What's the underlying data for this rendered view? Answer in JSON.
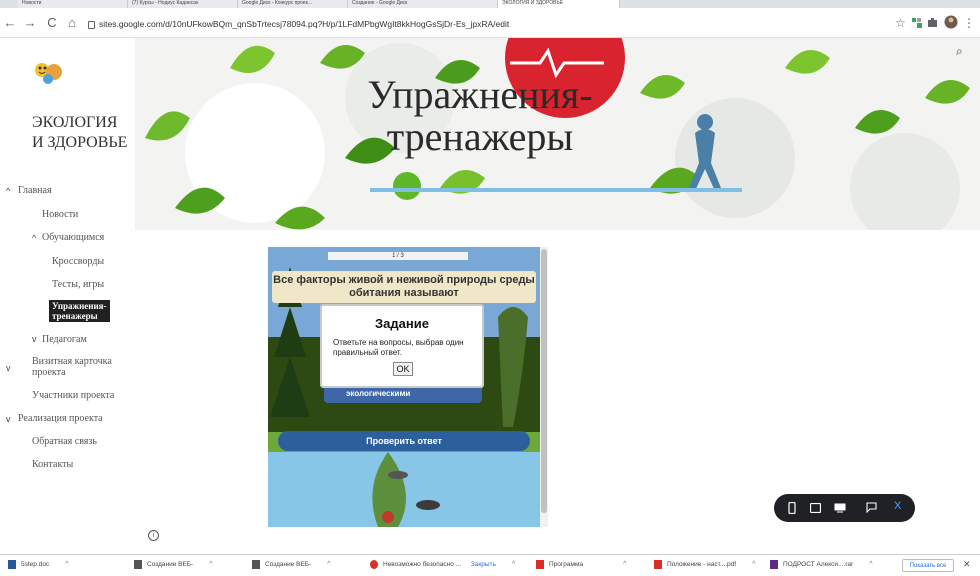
{
  "browser": {
    "tabs": [
      {
        "label": "Новости",
        "active": false
      },
      {
        "label": "(7) Курсы - Нодиус Кадансах",
        "active": false
      },
      {
        "label": "Google Диск - Конкурс проек...",
        "active": false
      },
      {
        "label": "Создание - Google Диск",
        "active": false
      },
      {
        "label": "ЭКОЛОГИЯ И ЗДОРОВЬЕ",
        "active": true
      }
    ],
    "back_label": "←",
    "forward_label": "→",
    "reload_label": "C",
    "home_label": "⌂",
    "url": "sites.google.com/d/10nUFkowBQm_qnSbTrtecsj78094.pq?H/p/1LFdMPbgWgIt8kkHogGsSjDr-Es_jpxRA/edit",
    "star_label": "☆",
    "menu_label": "⋮"
  },
  "sidebar": {
    "site_title_line1": "ЭКОЛОГИЯ",
    "site_title_line2": "И ЗДОРОВЬЕ",
    "items": [
      {
        "label": "Главная",
        "chevron": "^"
      },
      {
        "label": "Новости"
      },
      {
        "label": "Обучающимся",
        "chevron": "^"
      },
      {
        "label": "Кроссворды"
      },
      {
        "label": "Тесты, игры"
      },
      {
        "label_line1": "Упражнения-",
        "label_line2": "тренажеры",
        "active": true
      },
      {
        "label": "Педагогам",
        "chevron": "v"
      },
      {
        "label_line1": "Визитная карточка",
        "label_line2": "проекта",
        "chevron": "v"
      },
      {
        "label": "Участники проекта"
      },
      {
        "label": "Реализация проекта",
        "chevron": "v"
      },
      {
        "label": "Обратная связь"
      },
      {
        "label": "Контакты"
      }
    ]
  },
  "banner": {
    "title_line1": "Упражнения-",
    "title_line2": "тренажеры",
    "search_icon": "⌕"
  },
  "exercise": {
    "progress_text": "1 / 3",
    "question": "Все факторы живой и неживой природы среды обитания называют",
    "answer_partial": "экологическими",
    "check_button": "Проверить ответ",
    "modal": {
      "title": "Задание",
      "text": "Ответьте на вопросы, выбрав один правильный ответ.",
      "ok": "OK"
    }
  },
  "device_toolbar": {
    "close_label": "X"
  },
  "info_label": "i",
  "downloads": {
    "items": [
      {
        "label": "5step.doc"
      },
      {
        "label": "Создание ВЕБ-"
      },
      {
        "label": "Создание ВЕБ-"
      },
      {
        "label": "Невозможно безопасно ..."
      },
      {
        "label": "Программа"
      },
      {
        "label": "Положение - наст....pdf"
      },
      {
        "label": "ПОДРОСТ Алекси....rar"
      }
    ],
    "close_warning_label": "Закрыть",
    "show_all": "Показать все",
    "close_label": "✕"
  }
}
